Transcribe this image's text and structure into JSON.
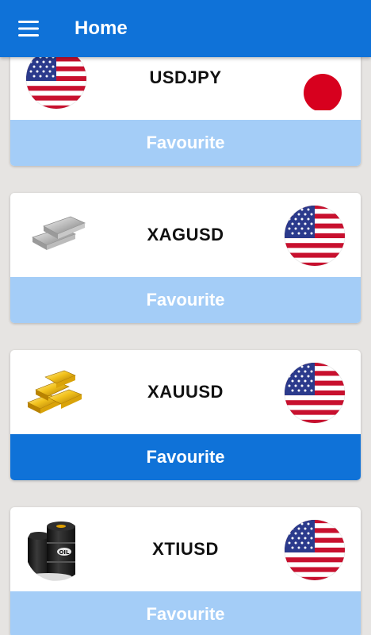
{
  "appbar": {
    "title": "Home",
    "menu_icon": "menu-icon",
    "color": "#0f72d8"
  },
  "colors": {
    "favourite_active": "#0f72d8",
    "favourite_inactive": "#a4cdf7",
    "background": "#e6e4e2"
  },
  "cards": [
    {
      "pair": "USDJPY",
      "left_icon": "us-flag-icon",
      "right_icon": "japan-flag-icon",
      "favourite_label": "Favourite",
      "favourite_active": false
    },
    {
      "pair": "XAGUSD",
      "left_icon": "silver-bars-icon",
      "right_icon": "us-flag-icon",
      "favourite_label": "Favourite",
      "favourite_active": false
    },
    {
      "pair": "XAUUSD",
      "left_icon": "gold-bars-icon",
      "right_icon": "us-flag-icon",
      "favourite_label": "Favourite",
      "favourite_active": true
    },
    {
      "pair": "XTIUSD",
      "left_icon": "oil-barrels-icon",
      "right_icon": "us-flag-icon",
      "favourite_label": "Favourite",
      "favourite_active": false
    }
  ]
}
